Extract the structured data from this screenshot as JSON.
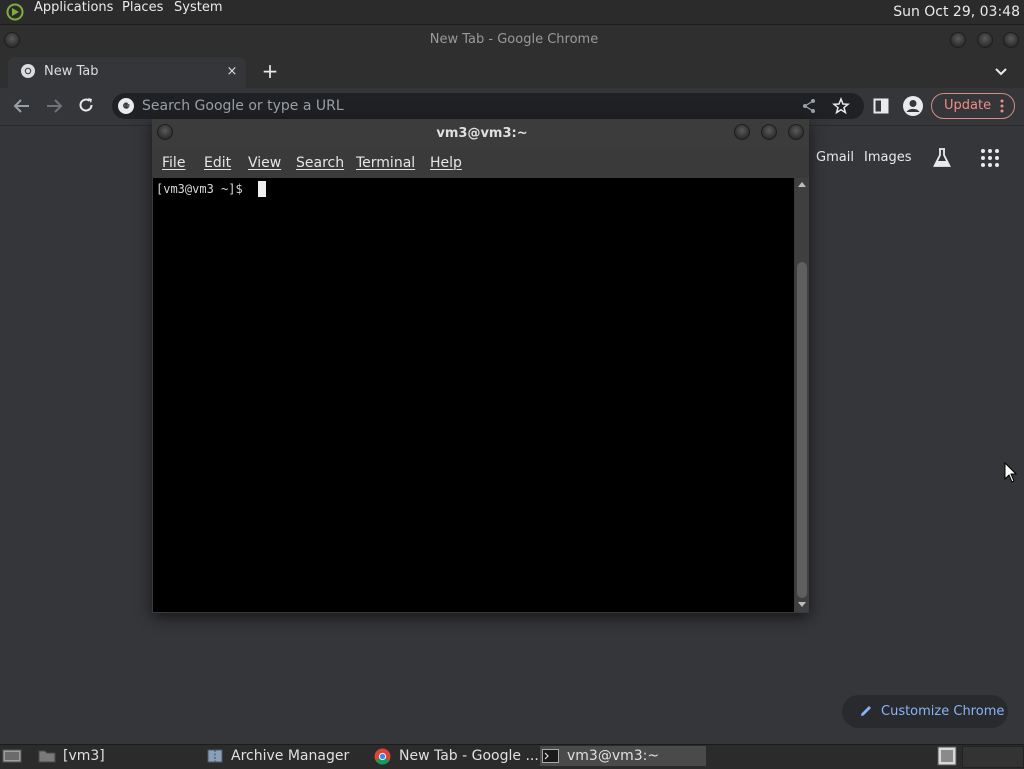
{
  "top_panel": {
    "menus": [
      "Applications",
      "Places",
      "System"
    ],
    "clock": "Sun Oct 29, 03:48"
  },
  "chrome": {
    "window_title": "New Tab - Google Chrome",
    "tab": {
      "title": "New Tab",
      "close": "×"
    },
    "new_tab": "+",
    "omnibox_placeholder": "Search Google or type a URL",
    "update_label": "Update",
    "ntp": {
      "gmail": "Gmail",
      "images": "Images",
      "customize": "Customize Chrome"
    }
  },
  "terminal": {
    "title": "vm3@vm3:~",
    "menu": [
      "File",
      "Edit",
      "View",
      "Search",
      "Terminal",
      "Help"
    ],
    "prompt": "[vm3@vm3 ~]$ "
  },
  "taskbar": {
    "items": [
      "[vm3]",
      "Archive Manager",
      "New Tab - Google ...",
      "vm3@vm3:~"
    ]
  },
  "colors": {
    "desktop_bg": "#35363a",
    "update_accent": "#f28b82",
    "customize_accent": "#8ab4f8",
    "terminal_bg": "#000000"
  }
}
